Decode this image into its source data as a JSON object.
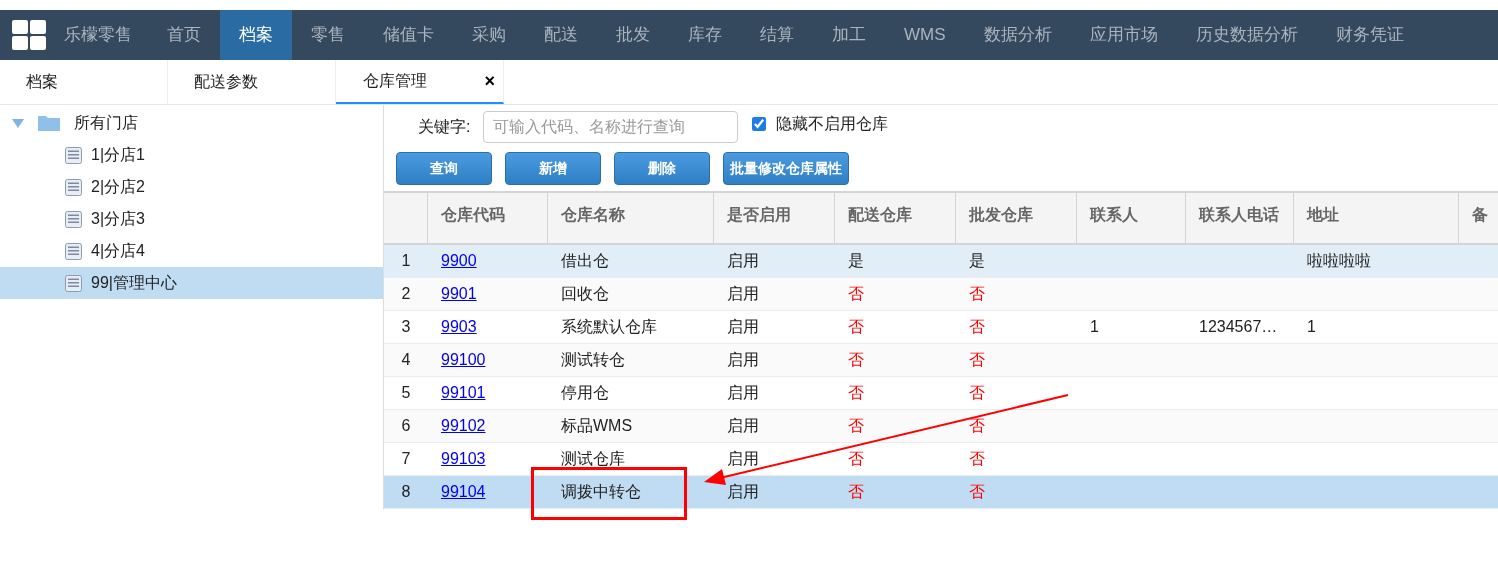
{
  "nav": {
    "brand": "乐檬零售",
    "items": [
      {
        "label": "首页",
        "selected": false
      },
      {
        "label": "档案",
        "selected": true
      },
      {
        "label": "零售",
        "selected": false
      },
      {
        "label": "储值卡",
        "selected": false
      },
      {
        "label": "采购",
        "selected": false
      },
      {
        "label": "配送",
        "selected": false
      },
      {
        "label": "批发",
        "selected": false
      },
      {
        "label": "库存",
        "selected": false
      },
      {
        "label": "结算",
        "selected": false
      },
      {
        "label": "加工",
        "selected": false
      },
      {
        "label": "WMS",
        "selected": false
      },
      {
        "label": "数据分析",
        "selected": false
      },
      {
        "label": "应用市场",
        "selected": false
      },
      {
        "label": "历史数据分析",
        "selected": false
      },
      {
        "label": "财务凭证",
        "selected": false
      }
    ]
  },
  "tabs": [
    {
      "label": "档案",
      "selected": false
    },
    {
      "label": "配送参数",
      "selected": false
    },
    {
      "label": "仓库管理",
      "selected": true,
      "close": "×"
    }
  ],
  "tree": {
    "label": "所有门店",
    "expanded": true,
    "children": [
      {
        "label": "1|分店1",
        "selected": false
      },
      {
        "label": "2|分店2",
        "selected": false
      },
      {
        "label": "3|分店3",
        "selected": false
      },
      {
        "label": "4|分店4",
        "selected": false
      },
      {
        "label": "99|管理中心",
        "selected": true
      }
    ]
  },
  "filter": {
    "label": "关键字:",
    "placeholder": "可输入代码、名称进行查询",
    "checkbox": {
      "label": "隐藏不启用仓库",
      "checked": true
    }
  },
  "buttons": [
    "查询",
    "新增",
    "删除",
    "批量修改仓库属性"
  ],
  "table": {
    "columns": [
      "仓库代码",
      "仓库名称",
      "是否启用",
      "配送仓库",
      "批发仓库",
      "联系人",
      "联系人电话",
      "地址",
      "备"
    ],
    "rows": [
      {
        "index": "1",
        "code": "9900",
        "name": "借出仓",
        "enabled": "启用",
        "distribution": {
          "text": "是",
          "negative": false
        },
        "wholesale": {
          "text": "是",
          "negative": false
        },
        "contact": "",
        "phone": "",
        "address": "啦啦啦啦",
        "hovered": true,
        "selected": false
      },
      {
        "index": "2",
        "code": "9901",
        "name": "回收仓",
        "enabled": "启用",
        "distribution": {
          "text": "否",
          "negative": true
        },
        "wholesale": {
          "text": "否",
          "negative": true
        },
        "contact": "",
        "phone": "",
        "address": "",
        "hovered": false,
        "selected": false
      },
      {
        "index": "3",
        "code": "9903",
        "name": "系统默认仓库",
        "enabled": "启用",
        "distribution": {
          "text": "否",
          "negative": true
        },
        "wholesale": {
          "text": "否",
          "negative": true
        },
        "contact": "1",
        "phone": "1234567…",
        "address": "1",
        "hovered": false,
        "selected": false
      },
      {
        "index": "4",
        "code": "99100",
        "name": "测试转仓",
        "enabled": "启用",
        "distribution": {
          "text": "否",
          "negative": true
        },
        "wholesale": {
          "text": "否",
          "negative": true
        },
        "contact": "",
        "phone": "",
        "address": "",
        "hovered": false,
        "selected": false
      },
      {
        "index": "5",
        "code": "99101",
        "name": "停用仓",
        "enabled": "启用",
        "distribution": {
          "text": "否",
          "negative": true
        },
        "wholesale": {
          "text": "否",
          "negative": true
        },
        "contact": "",
        "phone": "",
        "address": "",
        "hovered": false,
        "selected": false
      },
      {
        "index": "6",
        "code": "99102",
        "name": "标品WMS",
        "enabled": "启用",
        "distribution": {
          "text": "否",
          "negative": true
        },
        "wholesale": {
          "text": "否",
          "negative": true
        },
        "contact": "",
        "phone": "",
        "address": "",
        "hovered": false,
        "selected": false
      },
      {
        "index": "7",
        "code": "99103",
        "name": "测试仓库",
        "enabled": "启用",
        "distribution": {
          "text": "否",
          "negative": true
        },
        "wholesale": {
          "text": "否",
          "negative": true
        },
        "contact": "",
        "phone": "",
        "address": "",
        "hovered": false,
        "selected": false
      },
      {
        "index": "8",
        "code": "99104",
        "name": "调拨中转仓",
        "enabled": "启用",
        "distribution": {
          "text": "否",
          "negative": true
        },
        "wholesale": {
          "text": "否",
          "negative": true
        },
        "contact": "",
        "phone": "",
        "address": "",
        "hovered": false,
        "selected": true
      }
    ]
  },
  "annotations": [
    {
      "kind": "box"
    },
    {
      "kind": "arrow"
    }
  ]
}
